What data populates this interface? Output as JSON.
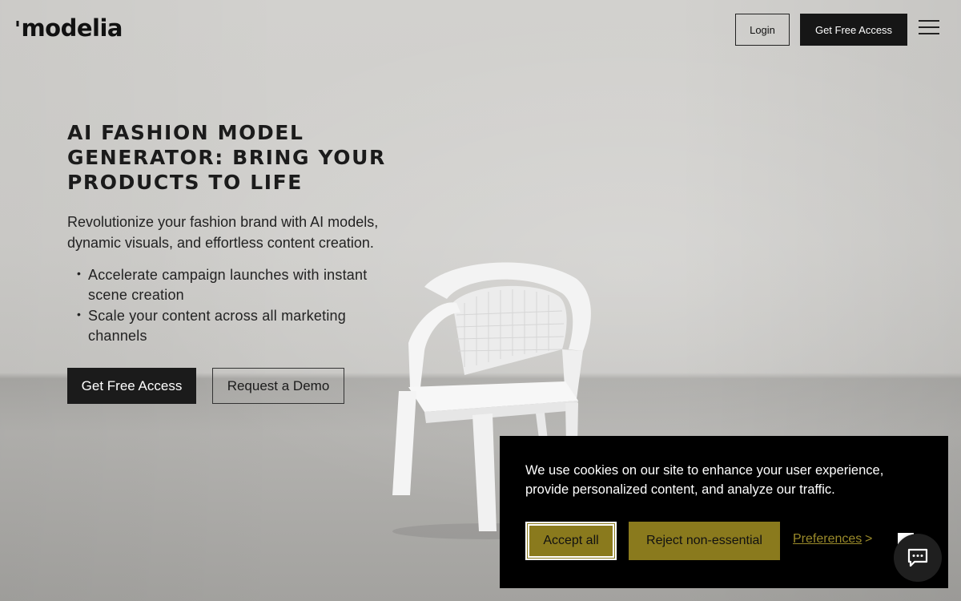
{
  "header": {
    "logo_text": "modelia",
    "login_label": "Login",
    "access_label": "Get Free Access",
    "menu_icon": "hamburger-menu-icon"
  },
  "hero": {
    "title": "AI Fashion Model Generator: Bring Your Products to Life",
    "subtitle": "Revolutionize your fashion brand with AI models, dynamic visuals, and effortless content creation.",
    "bullets": [
      "Accelerate campaign launches with instant scene creation",
      "Scale your content across all marketing channels"
    ],
    "cta_primary": "Get Free Access",
    "cta_secondary": "Request a Demo"
  },
  "cookie": {
    "message": "We use cookies on our site to enhance your user experience, provide personalized content, and analyze our traffic.",
    "accept_label": "Accept all",
    "reject_label": "Reject non-essential",
    "preferences_label": "Preferences",
    "preferences_arrow": ">",
    "accent_color": "#8a7a1d"
  },
  "chat": {
    "icon": "chat-bubble-icon"
  },
  "colors": {
    "primary_dark": "#1b1b1b",
    "background": "#c9c8c6"
  }
}
